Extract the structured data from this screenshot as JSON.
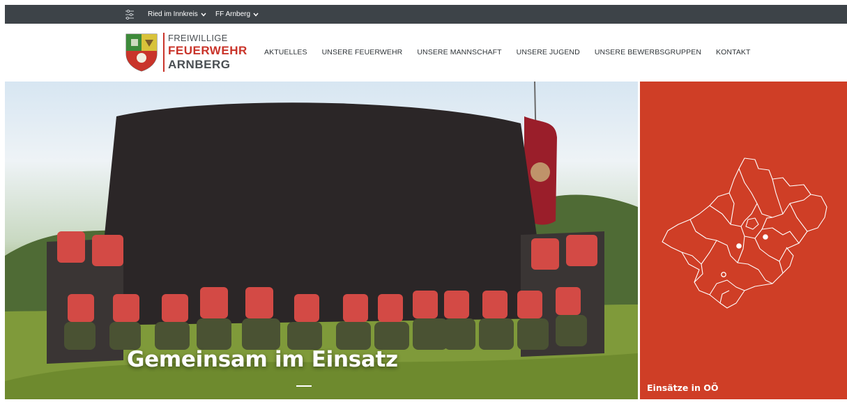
{
  "topbar": {
    "filter_icon": "sliders-icon",
    "location_dropdown": "Ried im Innkreis",
    "brigade_dropdown": "FF Arnberg"
  },
  "logo": {
    "line1": "FREIWILLIGE",
    "line2": "FEUERWEHR",
    "line3": "ARNBERG"
  },
  "nav": {
    "items": [
      "AKTUELLES",
      "UNSERE FEUERWEHR",
      "UNSERE MANNSCHAFT",
      "UNSERE JUGEND",
      "UNSERE BEWERBSGRUPPEN",
      "KONTAKT"
    ]
  },
  "hero": {
    "title": "Gemeinsam im Einsatz"
  },
  "sidebox": {
    "label": "Einsätze in OÖ",
    "map_icon": "upper-austria-map"
  },
  "colors": {
    "topbar": "#3d4348",
    "brand_red": "#c9342a",
    "sidebox": "#cf3e26",
    "text_dark": "#2f3438"
  }
}
